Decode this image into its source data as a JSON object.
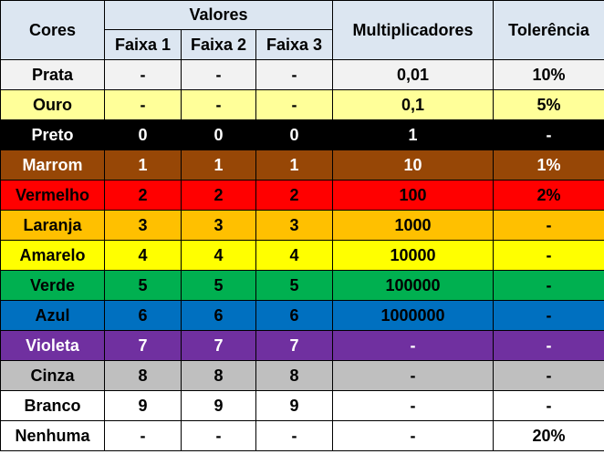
{
  "header": {
    "cores": "Cores",
    "valores": "Valores",
    "faixa1": "Faixa 1",
    "faixa2": "Faixa 2",
    "faixa3": "Faixa 3",
    "multiplicadores": "Multiplicadores",
    "tolerancia": "Tolerência"
  },
  "header_bg": "#dce6f1",
  "rows": [
    {
      "name": "Prata",
      "f1": "-",
      "f2": "-",
      "f3": "-",
      "mult": "0,01",
      "tol": "10%",
      "bg": "#f2f2f2",
      "fg": "#000000"
    },
    {
      "name": "Ouro",
      "f1": "-",
      "f2": "-",
      "f3": "-",
      "mult": "0,1",
      "tol": "5%",
      "bg": "#ffff99",
      "fg": "#000000"
    },
    {
      "name": "Preto",
      "f1": "0",
      "f2": "0",
      "f3": "0",
      "mult": "1",
      "tol": "-",
      "bg": "#000000",
      "fg": "#ffffff"
    },
    {
      "name": "Marrom",
      "f1": "1",
      "f2": "1",
      "f3": "1",
      "mult": "10",
      "tol": "1%",
      "bg": "#974706",
      "fg": "#ffffff"
    },
    {
      "name": "Vermelho",
      "f1": "2",
      "f2": "2",
      "f3": "2",
      "mult": "100",
      "tol": "2%",
      "bg": "#ff0000",
      "fg": "#000000"
    },
    {
      "name": "Laranja",
      "f1": "3",
      "f2": "3",
      "f3": "3",
      "mult": "1000",
      "tol": "-",
      "bg": "#ffc000",
      "fg": "#000000"
    },
    {
      "name": "Amarelo",
      "f1": "4",
      "f2": "4",
      "f3": "4",
      "mult": "10000",
      "tol": "-",
      "bg": "#ffff00",
      "fg": "#000000"
    },
    {
      "name": "Verde",
      "f1": "5",
      "f2": "5",
      "f3": "5",
      "mult": "100000",
      "tol": "-",
      "bg": "#00b050",
      "fg": "#000000"
    },
    {
      "name": "Azul",
      "f1": "6",
      "f2": "6",
      "f3": "6",
      "mult": "1000000",
      "tol": "-",
      "bg": "#0070c0",
      "fg": "#000000"
    },
    {
      "name": "Violeta",
      "f1": "7",
      "f2": "7",
      "f3": "7",
      "mult": "-",
      "tol": "-",
      "bg": "#7030a0",
      "fg": "#ffffff"
    },
    {
      "name": "Cinza",
      "f1": "8",
      "f2": "8",
      "f3": "8",
      "mult": "-",
      "tol": "-",
      "bg": "#bfbfbf",
      "fg": "#000000"
    },
    {
      "name": "Branco",
      "f1": "9",
      "f2": "9",
      "f3": "9",
      "mult": "-",
      "tol": "-",
      "bg": "#ffffff",
      "fg": "#000000"
    },
    {
      "name": "Nenhuma",
      "f1": "-",
      "f2": "-",
      "f3": "-",
      "mult": "-",
      "tol": "20%",
      "bg": "#ffffff",
      "fg": "#000000"
    }
  ]
}
